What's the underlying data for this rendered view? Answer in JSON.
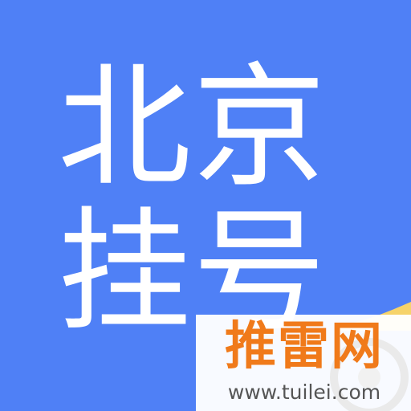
{
  "icon": {
    "background_color": "#4f80f6",
    "text_color": "#ffffff",
    "title_lines": [
      "北京",
      "挂号"
    ]
  },
  "watermark": {
    "brand": "推雷网",
    "url": "www.tuilei.com",
    "brand_color": "#f07a1a",
    "accent_color": "#f6d36a"
  }
}
